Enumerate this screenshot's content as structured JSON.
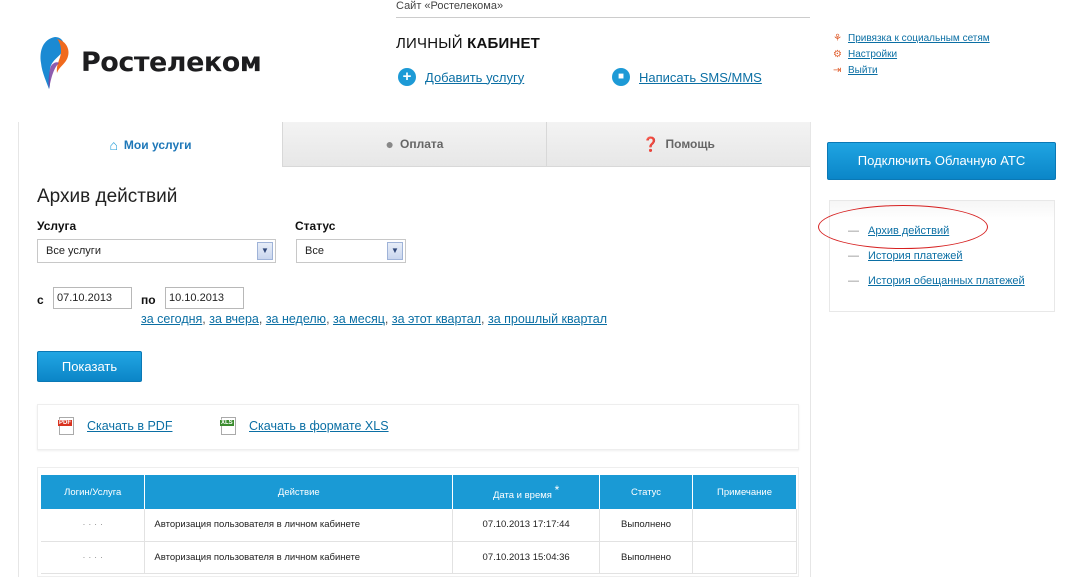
{
  "header": {
    "site_label": "Сайт «Ростелекома»",
    "logo_text": "Ростелеком",
    "cabinet_title_part1": "ЛИЧНЫЙ",
    "cabinet_title_part2": "КАБИНЕТ",
    "add_service": "Добавить услугу",
    "send_sms": "Написать SMS/MMS"
  },
  "user_menu": {
    "items": [
      {
        "label": "Привязка к социальным сетям",
        "icon": "social-link-icon"
      },
      {
        "label": "Настройки",
        "icon": "settings-icon"
      },
      {
        "label": "Выйти",
        "icon": "logout-icon"
      }
    ]
  },
  "tabs": [
    {
      "label": "Мои услуги",
      "icon": "home-icon",
      "active": true
    },
    {
      "label": "Оплата",
      "icon": "coins-icon",
      "active": false
    },
    {
      "label": "Помощь",
      "icon": "help-icon",
      "active": false
    }
  ],
  "filters": {
    "page_title": "Архив действий",
    "service_label": "Услуга",
    "service_value": "Все услуги",
    "status_label": "Статус",
    "status_value": "Все",
    "from_label": "с",
    "from_value": "07.10.2013",
    "to_label": "по",
    "to_value": "10.10.2013",
    "periods": [
      "за сегодня",
      "за вчера",
      "за неделю",
      "за месяц",
      "за этот квартал",
      "за прошлый квартал"
    ],
    "show_button": "Показать"
  },
  "downloads": {
    "pdf": "Скачать в PDF",
    "xls": "Скачать в формате XLS",
    "pdf_badge": "PDF",
    "xls_badge": "XLS"
  },
  "table": {
    "headers": [
      "Логин/Услуга",
      "Действие",
      "Дата и время",
      "Статус",
      "Примечание"
    ],
    "sort_marker": "*",
    "rows": [
      {
        "login": "· · ·   ·",
        "action": "Авторизация пользователя в личном кабинете",
        "datetime": "07.10.2013 17:17:44",
        "status": "Выполнено",
        "note": ""
      },
      {
        "login": "· ·   ·  ·",
        "action": "Авторизация пользователя в личном кабинете",
        "datetime": "07.10.2013 15:04:36",
        "status": "Выполнено",
        "note": ""
      }
    ]
  },
  "sidebar": {
    "cta_button": "Подключить Облачную АТС",
    "links": [
      "Архив действий",
      "История платежей",
      "История обещанных платежей"
    ]
  },
  "colors": {
    "accent": "#1a9ad5",
    "link": "#0b6fa4",
    "highlight_ellipse": "#d62020"
  }
}
